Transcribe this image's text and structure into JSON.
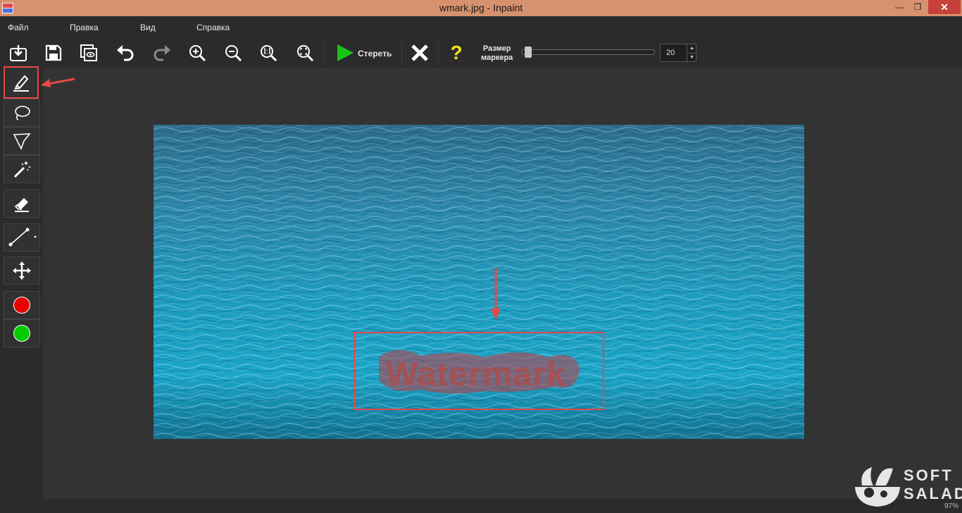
{
  "window": {
    "title": "wmark.jpg - Inpaint",
    "minimize_glyph": "—",
    "maximize_glyph": "❐",
    "close_glyph": "✕"
  },
  "menu": [
    "Файл",
    "Правка",
    "Вид",
    "Справка"
  ],
  "toolbar": {
    "buttons": [
      "open-icon",
      "save-icon",
      "preview-icon",
      "undo-icon",
      "redo-icon",
      "zoom-in-icon",
      "zoom-out-icon",
      "zoom-1to1-icon",
      "zoom-fit-icon"
    ],
    "erase_label": "Стереть",
    "cancel_icon": "close-icon",
    "help_glyph": "?",
    "marker_size_label_line1": "Размер",
    "marker_size_label_line2": "маркера",
    "marker_size_value": "20",
    "marker_size_fraction": 0.03
  },
  "tools": [
    "marker-icon",
    "lasso-icon",
    "polygonal-lasso-icon",
    "magic-wand-icon",
    "eraser-icon",
    "line-icon",
    "move-icon"
  ],
  "colors": {
    "red_swatch": "#e60000",
    "green_swatch": "#00cc00",
    "accent": "#e54848",
    "erase_play": "#19c219",
    "help_yellow": "#f2e21a"
  },
  "image": {
    "watermark_text": "Watermark"
  },
  "branding": {
    "line1": "SOFT",
    "line2": "SALAD"
  },
  "status": {
    "zoom": "97%"
  }
}
